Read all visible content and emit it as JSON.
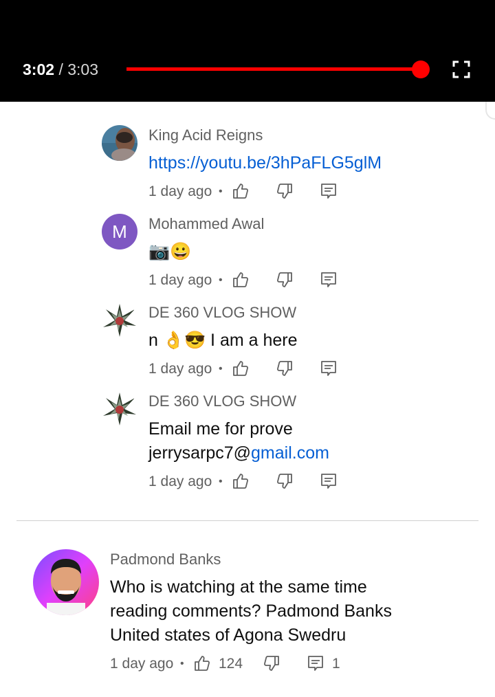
{
  "player": {
    "current_time": "3:02",
    "separator": "/",
    "duration": "3:03",
    "progress": 0.995,
    "accent_color": "#ff0000",
    "fullscreen_icon": "fullscreen-icon"
  },
  "replies": [
    {
      "author": "King Acid Reigns",
      "text_link": "https://youtu.be/3hPaFLG5glM",
      "time": "1 day ago",
      "dot": "•"
    },
    {
      "author": "Mohammed Awal",
      "avatar_letter": "M",
      "avatar_color": "#7e57c2",
      "text": "📷😀",
      "time": "1 day ago",
      "dot": "•"
    },
    {
      "author": "DE 360 VLOG SHOW",
      "text": "n 👌😎 I am a here",
      "time": "1 day ago",
      "dot": "•"
    },
    {
      "author": "DE 360 VLOG SHOW",
      "text_line1": "Email me for prove",
      "text_line2_plain": "jerrysarpc7@",
      "text_line2_link": "gmail.com",
      "time": "1 day ago",
      "dot": "•"
    }
  ],
  "comment": {
    "author": "Padmond Banks",
    "lines": [
      "Who is watching at the same time",
      "reading comments? Padmond Banks",
      "United states of Agona Swedru"
    ],
    "time": "1 day ago",
    "dot": "•",
    "like_count": "124",
    "reply_count": "1"
  },
  "icons": {
    "like": "thumb-up-icon",
    "dislike": "thumb-down-icon",
    "reply": "reply-icon"
  }
}
